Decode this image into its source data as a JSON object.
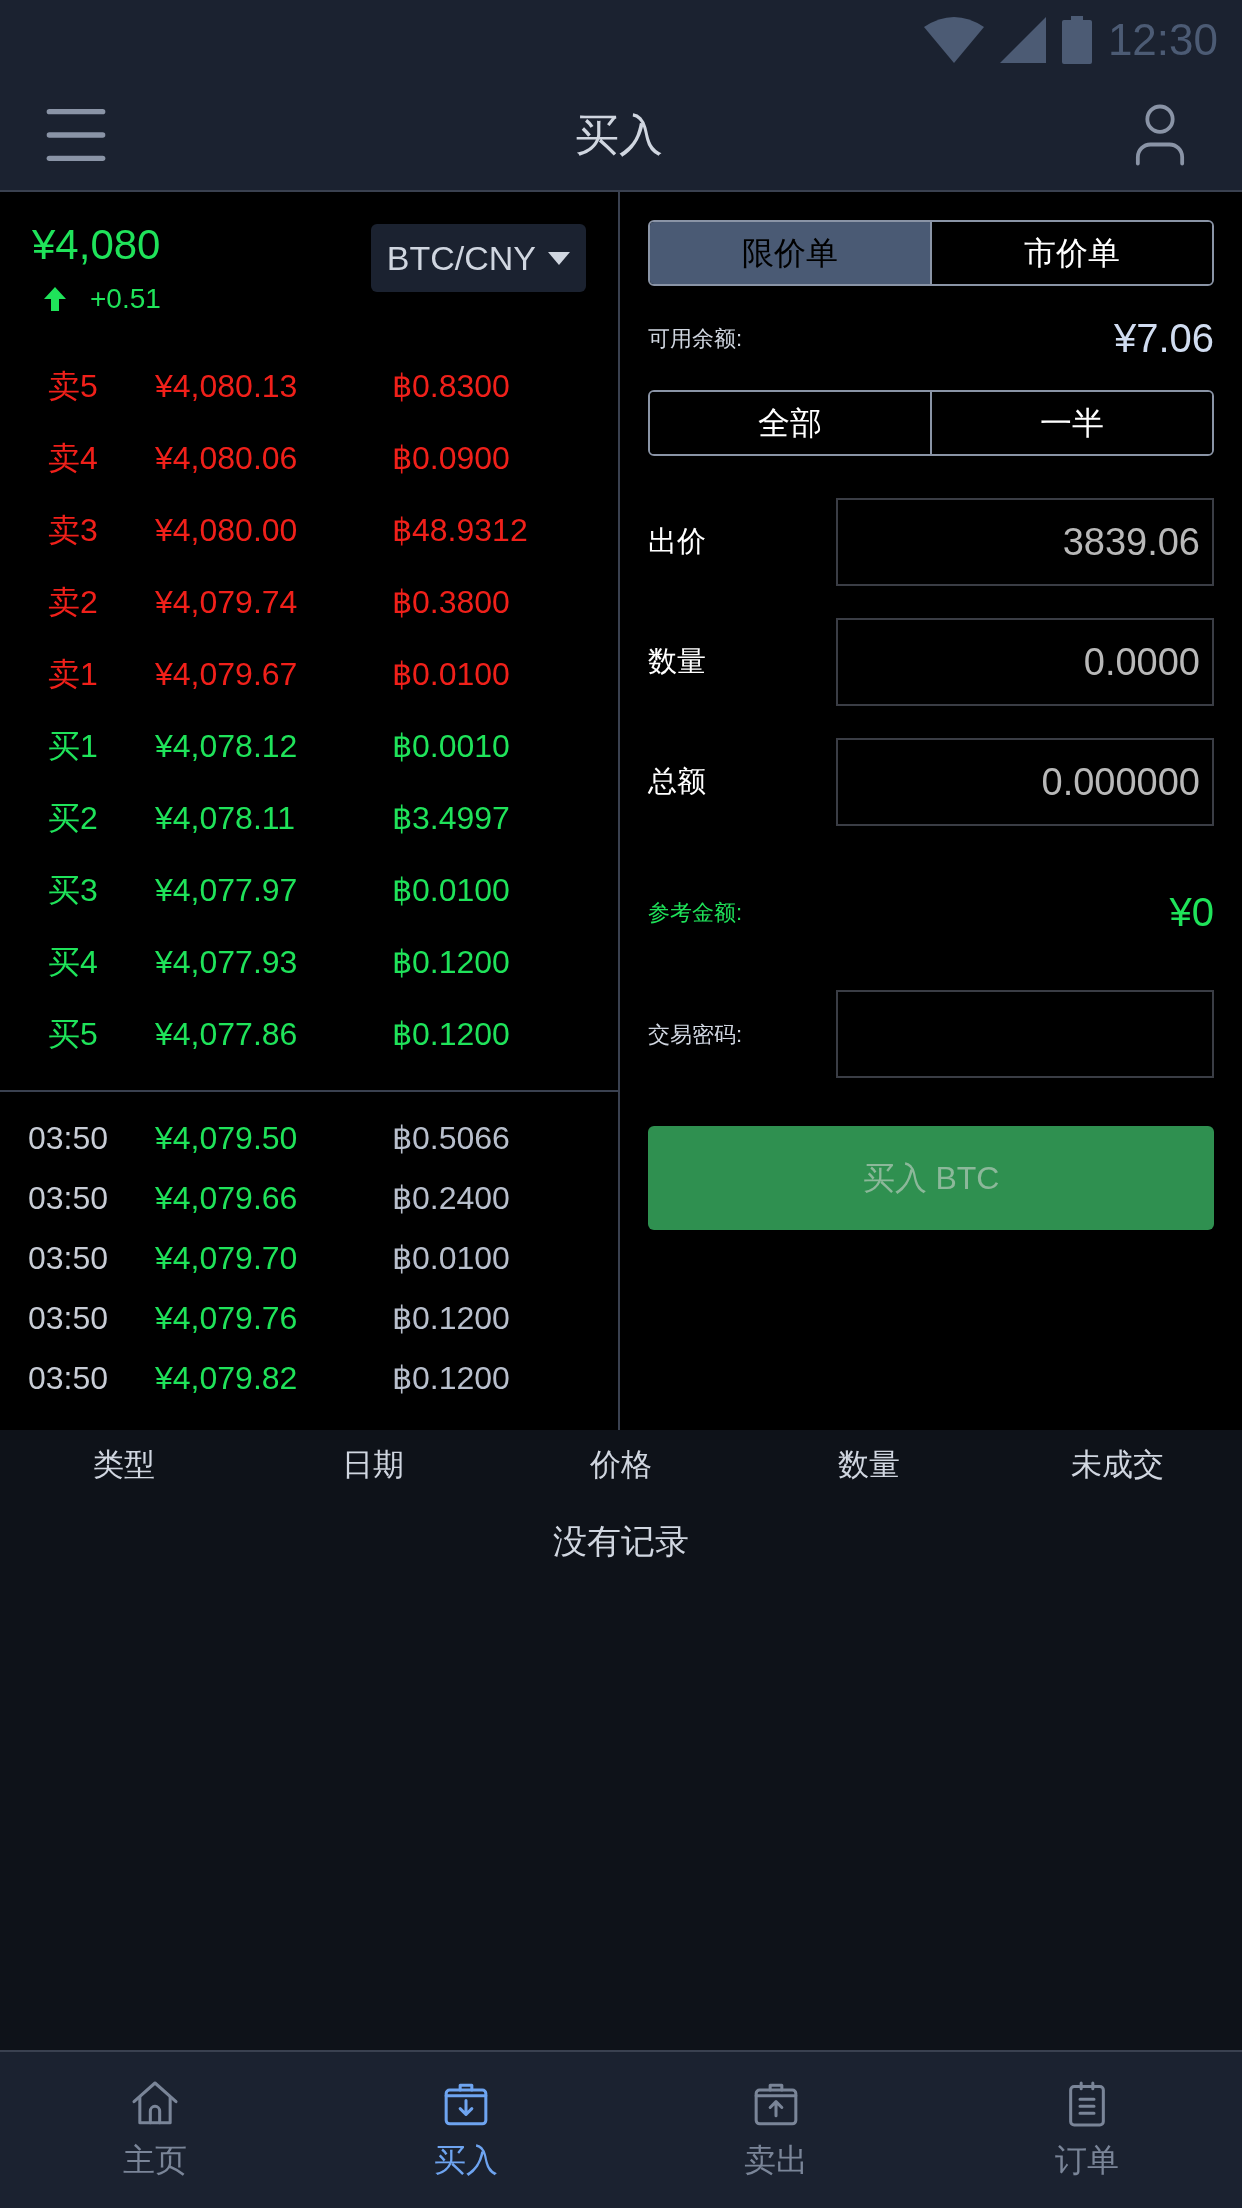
{
  "status_bar": {
    "time": "12:30"
  },
  "header": {
    "title": "买入"
  },
  "ticker": {
    "price": "¥4,080",
    "change": "+0.51",
    "pair": "BTC/CNY"
  },
  "order_book": [
    {
      "kind": "sell",
      "label": "卖5",
      "price": "¥4,080.13",
      "amount": "฿0.8300"
    },
    {
      "kind": "sell",
      "label": "卖4",
      "price": "¥4,080.06",
      "amount": "฿0.0900"
    },
    {
      "kind": "sell",
      "label": "卖3",
      "price": "¥4,080.00",
      "amount": "฿48.9312"
    },
    {
      "kind": "sell",
      "label": "卖2",
      "price": "¥4,079.74",
      "amount": "฿0.3800"
    },
    {
      "kind": "sell",
      "label": "卖1",
      "price": "¥4,079.67",
      "amount": "฿0.0100"
    },
    {
      "kind": "buy",
      "label": "买1",
      "price": "¥4,078.12",
      "amount": "฿0.0010"
    },
    {
      "kind": "buy",
      "label": "买2",
      "price": "¥4,078.11",
      "amount": "฿3.4997"
    },
    {
      "kind": "buy",
      "label": "买3",
      "price": "¥4,077.97",
      "amount": "฿0.0100"
    },
    {
      "kind": "buy",
      "label": "买4",
      "price": "¥4,077.93",
      "amount": "฿0.1200"
    },
    {
      "kind": "buy",
      "label": "买5",
      "price": "¥4,077.86",
      "amount": "฿0.1200"
    }
  ],
  "trades": [
    {
      "time": "03:50",
      "price": "¥4,079.50",
      "amount": "฿0.5066"
    },
    {
      "time": "03:50",
      "price": "¥4,079.66",
      "amount": "฿0.2400"
    },
    {
      "time": "03:50",
      "price": "¥4,079.70",
      "amount": "฿0.0100"
    },
    {
      "time": "03:50",
      "price": "¥4,079.76",
      "amount": "฿0.1200"
    },
    {
      "time": "03:50",
      "price": "¥4,079.82",
      "amount": "฿0.1200"
    }
  ],
  "order_form": {
    "order_types": [
      {
        "label": "限价单",
        "selected": true
      },
      {
        "label": "市价单",
        "selected": false
      }
    ],
    "balance_label": "可用余额:",
    "balance": "¥7.06",
    "quick_buttons": [
      "全部",
      "一半"
    ],
    "fields": [
      {
        "label": "出价",
        "value": "3839.06"
      },
      {
        "label": "数量",
        "value": "0.0000"
      },
      {
        "label": "总额",
        "value": "0.000000"
      }
    ],
    "reference_label": "参考金额:",
    "reference_value": "¥0",
    "password_label": "交易密码:",
    "submit": {
      "label": "买入 BTC",
      "disabled": true
    }
  },
  "orders_table": {
    "columns": [
      "类型",
      "日期",
      "价格",
      "数量",
      "未成交"
    ],
    "empty_text": "没有记录"
  },
  "tab_bar": [
    {
      "kind": "home",
      "label": "主页",
      "selected": false
    },
    {
      "kind": "buy",
      "label": "买入",
      "selected": true
    },
    {
      "kind": "sell",
      "label": "卖出",
      "selected": false
    },
    {
      "kind": "orders",
      "label": "订单",
      "selected": false
    }
  ]
}
